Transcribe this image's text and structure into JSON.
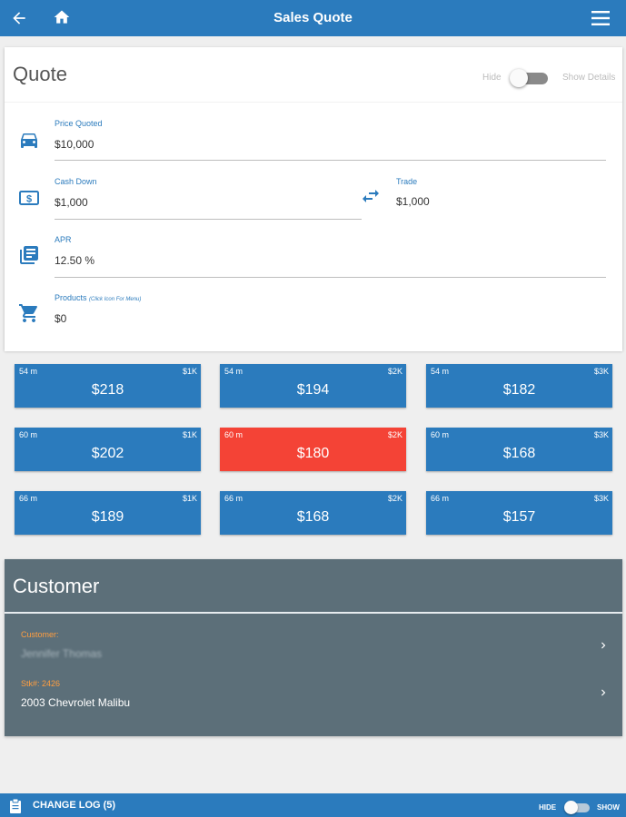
{
  "app": {
    "title": "Sales Quote"
  },
  "quote": {
    "title": "Quote",
    "toggle": {
      "hide_label": "Hide",
      "show_label": "Show Details"
    },
    "price_quoted": {
      "label": "Price Quoted",
      "value": "$10,000"
    },
    "cash_down": {
      "label": "Cash Down",
      "value": "$1,000"
    },
    "trade": {
      "label": "Trade",
      "value": "$1,000"
    },
    "apr": {
      "label": "APR",
      "value": "12.50 %"
    },
    "products": {
      "label": "Products",
      "hint": "(Click Icon For Menu)",
      "value": "$0"
    }
  },
  "payments": [
    {
      "term": "54 m",
      "down": "$1K",
      "amount": "$218",
      "selected": false
    },
    {
      "term": "54 m",
      "down": "$2K",
      "amount": "$194",
      "selected": false
    },
    {
      "term": "54 m",
      "down": "$3K",
      "amount": "$182",
      "selected": false
    },
    {
      "term": "60 m",
      "down": "$1K",
      "amount": "$202",
      "selected": false
    },
    {
      "term": "60 m",
      "down": "$2K",
      "amount": "$180",
      "selected": true
    },
    {
      "term": "60 m",
      "down": "$3K",
      "amount": "$168",
      "selected": false
    },
    {
      "term": "66 m",
      "down": "$1K",
      "amount": "$189",
      "selected": false
    },
    {
      "term": "66 m",
      "down": "$2K",
      "amount": "$168",
      "selected": false
    },
    {
      "term": "66 m",
      "down": "$3K",
      "amount": "$157",
      "selected": false
    }
  ],
  "customer": {
    "title": "Customer",
    "customer_row": {
      "label": "Customer:",
      "value": "Jennifer Thomas"
    },
    "vehicle_row": {
      "label": "Stk#: 2426",
      "value": "2003 Chevrolet Malibu"
    }
  },
  "footer": {
    "change_log": "CHANGE LOG (5)",
    "hide_label": "HIDE",
    "show_label": "SHOW"
  },
  "colors": {
    "primary": "#2b7bbd",
    "selected": "#f44336",
    "customer_bg": "#5c6f79",
    "accent": "#ff9e40"
  },
  "icons": {
    "back": "arrow-left-icon",
    "home": "home-icon",
    "menu": "hamburger-menu-icon",
    "car": "car-icon",
    "cash": "dollar-bill-icon",
    "swap": "swap-arrows-icon",
    "apr": "document-list-icon",
    "cart": "shopping-cart-icon",
    "chevron": "chevron-right-icon",
    "clipboard": "clipboard-icon"
  }
}
